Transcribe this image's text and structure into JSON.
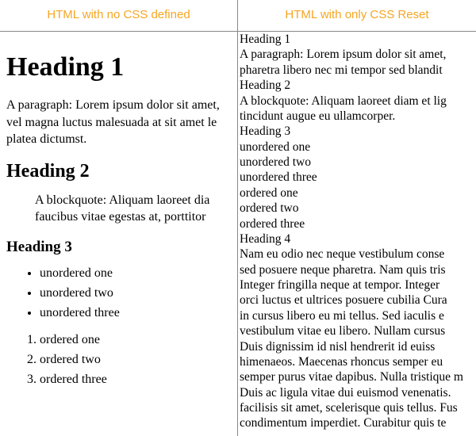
{
  "left": {
    "header": "HTML with no CSS defined",
    "h1": "Heading 1",
    "para1": "A paragraph: Lorem ipsum dolor sit amet, vel magna luctus malesuada at sit amet le platea dictumst.",
    "h2": "Heading 2",
    "blockquote": "A blockquote: Aliquam laoreet dia faucibus vitae egestas at, porttitor",
    "h3": "Heading 3",
    "ul": [
      "unordered one",
      "unordered two",
      "unordered three"
    ],
    "ol": [
      "ordered one",
      "ordered two",
      "ordered three"
    ]
  },
  "right": {
    "header": "HTML with only CSS Reset",
    "lines": [
      "Heading 1",
      "A paragraph: Lorem ipsum dolor sit amet,",
      "pharetra libero nec mi tempor sed blandit",
      "Heading 2",
      "A blockquote: Aliquam laoreet diam et lig",
      "tincidunt augue eu ullamcorper.",
      "Heading 3",
      "unordered one",
      "unordered two",
      "unordered three",
      "ordered one",
      "ordered two",
      "ordered three",
      "Heading 4",
      "Nam eu odio nec neque vestibulum conse",
      "sed posuere neque pharetra. Nam quis tris",
      "Integer fringilla neque at tempor. Integer",
      "orci luctus et ultrices posuere cubilia Cura",
      "in cursus libero eu mi tellus. Sed iaculis e",
      "vestibulum vitae eu libero. Nullam cursus",
      "Duis dignissim id nisl hendrerit id euiss",
      "himenaeos. Maecenas rhoncus semper eu",
      "semper purus vitae dapibus. Nulla tristique m",
      "Duis ac ligula vitae dui euismod venenatis.",
      "facilisis sit amet, scelerisque quis tellus. Fus",
      "condimentum imperdiet. Curabitur quis te"
    ]
  }
}
